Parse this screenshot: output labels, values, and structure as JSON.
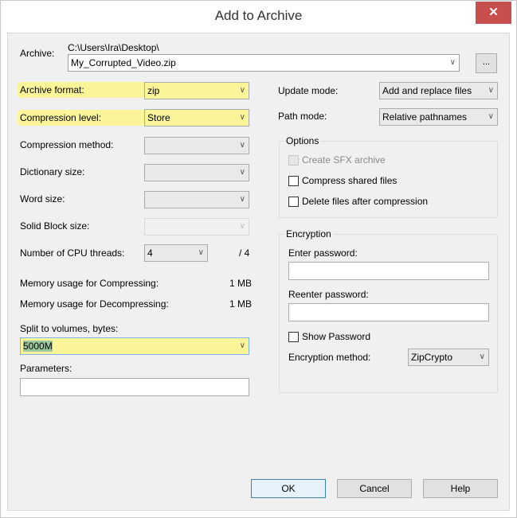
{
  "window": {
    "title": "Add to Archive",
    "close_icon": "close-icon (x)"
  },
  "archive": {
    "label": "Archive:",
    "path": "C:\\Users\\Ira\\Desktop\\",
    "filename": "My_Corrupted_Video.zip",
    "browse_label": "..."
  },
  "left": {
    "archive_format": {
      "label": "Archive format:",
      "value": "zip",
      "highlighted": true
    },
    "compression_level": {
      "label": "Compression level:",
      "value": "Store",
      "highlighted": true
    },
    "compression_method": {
      "label": "Compression method:",
      "value": ""
    },
    "dictionary_size": {
      "label": "Dictionary size:",
      "value": ""
    },
    "word_size": {
      "label": "Word size:",
      "value": ""
    },
    "solid_block_size": {
      "label": "Solid Block size:",
      "value": "",
      "disabled": true
    },
    "cpu_threads": {
      "label": "Number of CPU threads:",
      "value": "4",
      "max": "/ 4"
    },
    "mem_compress": {
      "label": "Memory usage for Compressing:",
      "value": "1 MB"
    },
    "mem_decompress": {
      "label": "Memory usage for Decompressing:",
      "value": "1 MB"
    },
    "split_volumes": {
      "label": "Split to volumes, bytes:",
      "value": "5000M",
      "highlighted": true
    },
    "parameters": {
      "label": "Parameters:",
      "value": ""
    }
  },
  "right": {
    "update_mode": {
      "label": "Update mode:",
      "value": "Add and replace files"
    },
    "path_mode": {
      "label": "Path mode:",
      "value": "Relative pathnames"
    },
    "options": {
      "title": "Options",
      "items": [
        {
          "label": "Create SFX archive",
          "checked": false,
          "disabled": true
        },
        {
          "label": "Compress shared files",
          "checked": false,
          "disabled": false
        },
        {
          "label": "Delete files after compression",
          "checked": false,
          "disabled": false
        }
      ]
    },
    "encryption": {
      "title": "Encryption",
      "enter_password_label": "Enter password:",
      "reenter_password_label": "Reenter password:",
      "show_password_label": "Show Password",
      "show_password_checked": false,
      "method_label": "Encryption method:",
      "method_value": "ZipCrypto"
    }
  },
  "buttons": {
    "ok": "OK",
    "cancel": "Cancel",
    "help": "Help"
  },
  "colors": {
    "highlight": "#fbf59a",
    "close_button": "#c7504f",
    "default_button_border": "#3c7fb1"
  }
}
